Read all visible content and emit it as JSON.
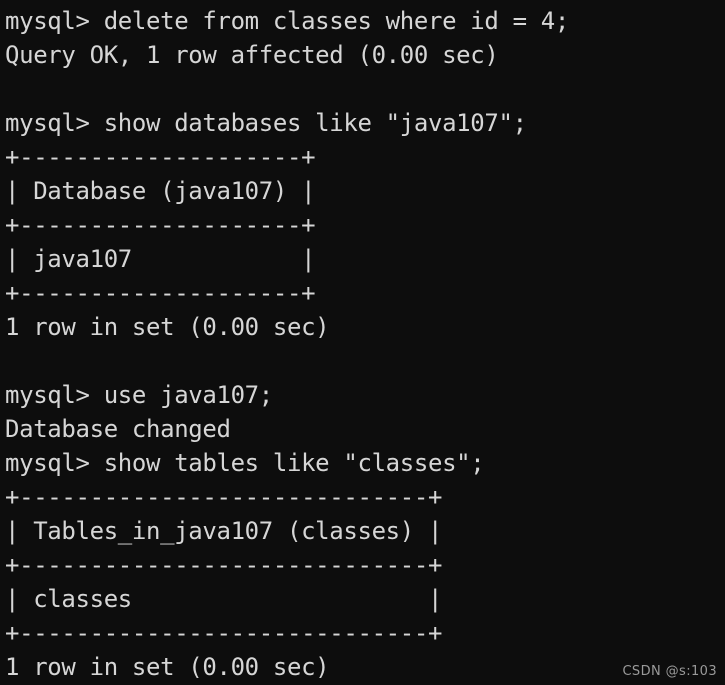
{
  "terminal": {
    "background_color": "#0d0d0d",
    "text_color": "#d6d6d6",
    "prompt": "mysql>",
    "lines": [
      "mysql> delete from classes where id = 4;",
      "Query OK, 1 row affected (0.00 sec)",
      "",
      "mysql> show databases like \"java107\";",
      "+--------------------+",
      "| Database (java107) |",
      "+--------------------+",
      "| java107            |",
      "+--------------------+",
      "1 row in set (0.00 sec)",
      "",
      "mysql> use java107;",
      "Database changed",
      "mysql> show tables like \"classes\";",
      "+-----------------------------+",
      "| Tables_in_java107 (classes) |",
      "+-----------------------------+",
      "| classes                     |",
      "+-----------------------------+",
      "1 row in set (0.00 sec)"
    ]
  },
  "watermark": {
    "text": "CSDN @s:103",
    "color": "#9a9a9a"
  }
}
